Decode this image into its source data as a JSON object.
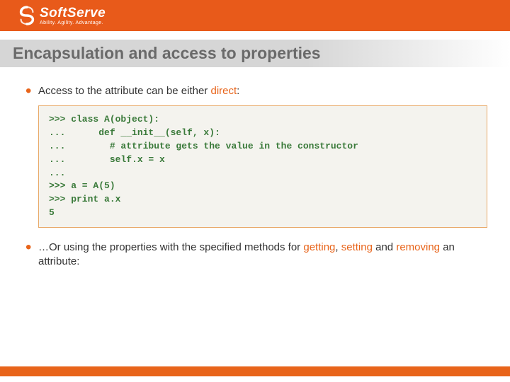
{
  "header": {
    "logo_name": "SoftServe",
    "logo_tagline": "Ability. Agility. Advantage."
  },
  "title": "Encapsulation and access to properties",
  "bullets": {
    "b1_pre": "Access to the attribute can be either ",
    "b1_accent": "direct",
    "b1_post": ":",
    "b2_pre": "…Or using the properties with the specified methods for ",
    "b2_a1": "getting",
    "b2_s1": ", ",
    "b2_a2": "setting",
    "b2_s2": " and ",
    "b2_a3": "removing",
    "b2_post": " an attribute:"
  },
  "code": ">>> class A(object):\n...      def __init__(self, x):\n...        # attribute gets the value in the constructor\n...        self.x = x\n...\n>>> a = A(5)\n>>> print a.x\n5"
}
